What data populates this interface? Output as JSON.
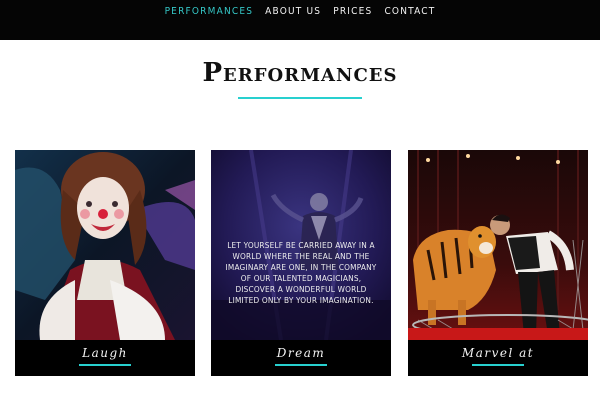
{
  "nav": {
    "items": [
      {
        "label": "Performances",
        "active": true
      },
      {
        "label": "About us",
        "active": false
      },
      {
        "label": "Prices",
        "active": false
      },
      {
        "label": "Contact",
        "active": false
      }
    ]
  },
  "section": {
    "title": "Performances"
  },
  "cards": [
    {
      "caption": "Laugh",
      "image": "clown-photo"
    },
    {
      "caption": "Dream",
      "image": "magician-photo",
      "overlay": "Let yourself be carried away in a world where the real and the imaginary are one, in the company of our talented magicians, discover a wonderful world limited only by your imagination."
    },
    {
      "caption": "Marvel at",
      "image": "tiger-tamer-photo"
    }
  ],
  "colors": {
    "accent": "#28d0cf",
    "nav_bg": "#050505"
  }
}
